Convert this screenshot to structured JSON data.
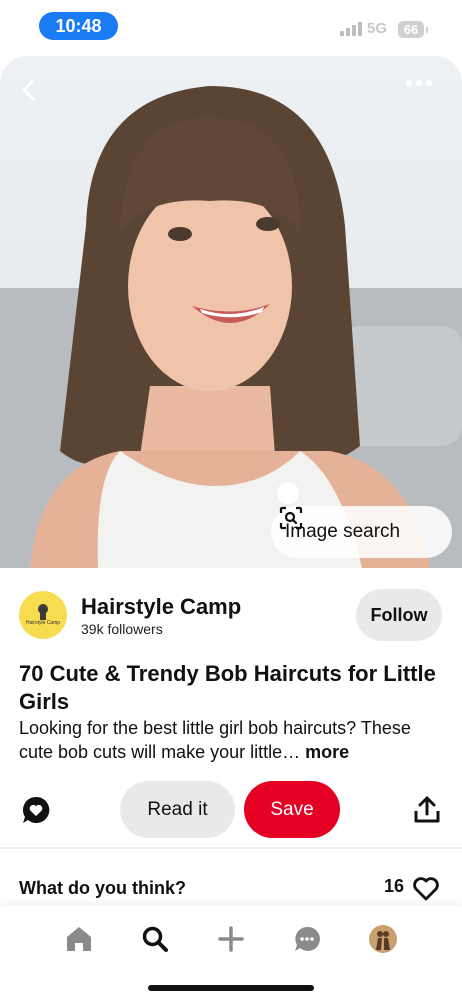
{
  "status_bar": {
    "time": "10:48",
    "network": "5G",
    "battery": "66"
  },
  "pin": {
    "image_search_label": "Image search",
    "creator": {
      "name": "Hairstyle Camp",
      "followers": "39k followers",
      "avatar_text": "Hairstyle Camp"
    },
    "follow_label": "Follow",
    "title": "70 Cute & Trendy Bob Haircuts for Little Girls",
    "description": "Looking for the best little girl bob haircuts? These cute bob cuts will make your little…",
    "more_label": "more"
  },
  "actions": {
    "read_label": "Read it",
    "save_label": "Save"
  },
  "comments": {
    "prompt": "What do you think?",
    "reaction_count": "16"
  },
  "colors": {
    "save_red": "#e60023",
    "time_blue": "#1a7cf5",
    "avatar_yellow": "#f7dc4f"
  },
  "icons": [
    "back-icon",
    "more-options-icon",
    "image-search-icon",
    "comment-icon",
    "share-icon",
    "heart-icon",
    "home-icon",
    "search-icon",
    "create-icon",
    "messages-icon",
    "profile-icon"
  ]
}
